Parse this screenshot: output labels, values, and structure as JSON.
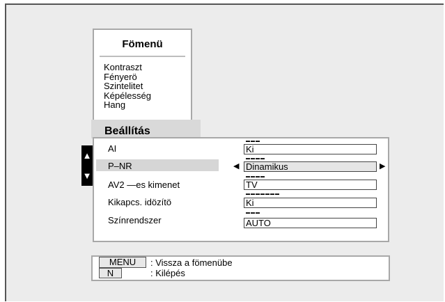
{
  "main_menu": {
    "title": "Fömenü",
    "items": [
      "Kontraszt",
      "Fényerö",
      "Szintelitet",
      "Képélesség",
      "Hang"
    ]
  },
  "settings": {
    "title": "Beállítás",
    "rows": [
      {
        "label": "AI",
        "value": "Ki",
        "indicator": "▬▬▬",
        "selected": false
      },
      {
        "label": "P–NR",
        "value": "Dinamikus",
        "indicator": "▬▬▬▬",
        "selected": true
      },
      {
        "label": "AV2 —es kimenet",
        "value": "TV",
        "indicator": "▬▬▬▬",
        "selected": false
      },
      {
        "label": "Kikapcs. idözítö",
        "value": "Ki",
        "indicator": "▬▬▬▬▬▬▬",
        "selected": false
      },
      {
        "label": "Színrendszer",
        "value": "AUTO",
        "indicator": "▬▬▬",
        "selected": false
      }
    ],
    "up_arrow": "▲",
    "down_arrow": "▼",
    "left_arrow": "◀",
    "right_arrow": "▶"
  },
  "help": {
    "menu_key": "MENU",
    "menu_text": ": Vissza a fömenübe",
    "n_key": "N",
    "n_text": ": Kilépés"
  }
}
